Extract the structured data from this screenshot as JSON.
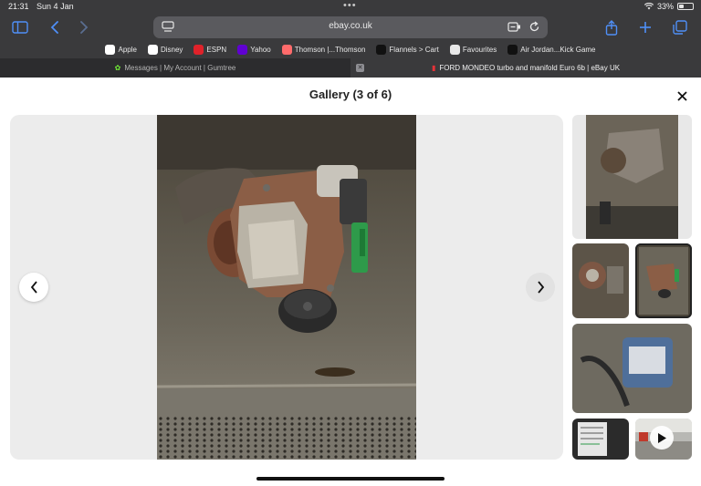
{
  "status": {
    "time": "21:31",
    "date": "Sun 4 Jan",
    "battery": "33%",
    "battery_level": 0.33
  },
  "browser": {
    "url": "ebay.co.uk",
    "bookmarks": [
      {
        "label": "Apple",
        "icon": "apple-icon",
        "color": "#ffffff"
      },
      {
        "label": "Disney",
        "icon": "disney-icon",
        "color": "#ffffff"
      },
      {
        "label": "ESPN",
        "icon": "espn-icon",
        "color": "#e0222a"
      },
      {
        "label": "Yahoo",
        "icon": "yahoo-icon",
        "color": "#6001d2"
      },
      {
        "label": "Thomson |...Thomson",
        "icon": "thomson-icon",
        "color": "#ff6b6b"
      },
      {
        "label": "Flannels > Cart",
        "icon": "flannels-icon",
        "color": "#111111"
      },
      {
        "label": "Favourites",
        "icon": "crown-icon",
        "color": "#e8e8e8"
      },
      {
        "label": "Air Jordan...Kick Game",
        "icon": "kickgame-icon",
        "color": "#111111"
      }
    ],
    "tabs": [
      {
        "label": "Messages | My Account | Gumtree",
        "active": false
      },
      {
        "label": "FORD MONDEO turbo and manifold Euro 6b | eBay UK",
        "active": true
      }
    ]
  },
  "gallery": {
    "title": "Gallery (3 of 6)",
    "thumbnail_count": 6,
    "selected_index": 3
  },
  "colors": {
    "accent": "#4f8ff7",
    "chrome_bg": "#3a3a3c",
    "tab_bg": "#2c2c2e"
  }
}
